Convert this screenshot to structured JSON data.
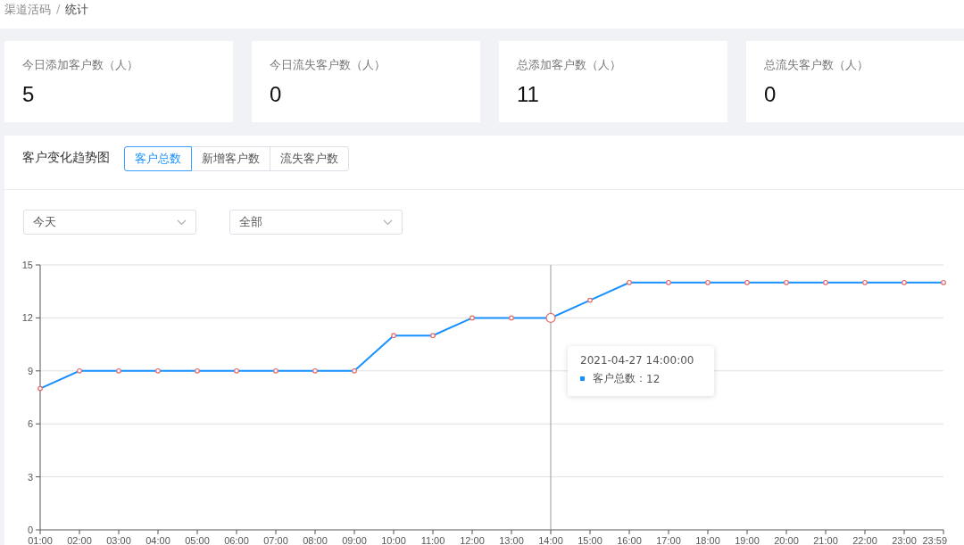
{
  "breadcrumb": [
    {
      "label": "渠道活码"
    },
    {
      "label": "统计"
    }
  ],
  "breadcrumb_separator": "/",
  "stats": [
    {
      "label": "今日添加客户数（人）",
      "value": "5"
    },
    {
      "label": "今日流失客户数（人）",
      "value": "0"
    },
    {
      "label": "总添加客户数（人）",
      "value": "11"
    },
    {
      "label": "总流失客户数（人）",
      "value": "0"
    }
  ],
  "trend": {
    "title": "客户变化趋势图",
    "tabs": [
      {
        "label": "客户总数",
        "selected": true
      },
      {
        "label": "新增客户数",
        "selected": false
      },
      {
        "label": "流失客户数",
        "selected": false
      }
    ],
    "filters": [
      {
        "value": "今天"
      },
      {
        "value": "全部"
      }
    ],
    "chart_data": {
      "type": "line",
      "categories": [
        "01:00",
        "02:00",
        "03:00",
        "04:00",
        "05:00",
        "06:00",
        "07:00",
        "08:00",
        "09:00",
        "10:00",
        "11:00",
        "12:00",
        "13:00",
        "14:00",
        "15:00",
        "16:00",
        "17:00",
        "18:00",
        "19:00",
        "20:00",
        "21:00",
        "22:00",
        "23:00",
        "23:59"
      ],
      "series": [
        {
          "name": "客户总数",
          "color": "#1890ff",
          "marker": "circle",
          "values": [
            8,
            9,
            9,
            9,
            9,
            9,
            9,
            9,
            9,
            11,
            11,
            12,
            12,
            12,
            13,
            14,
            14,
            14,
            14,
            14,
            14,
            14,
            14,
            14
          ]
        }
      ],
      "ylim": [
        0,
        15
      ],
      "yticks": [
        0,
        3,
        6,
        9,
        12,
        15
      ],
      "grid": true,
      "ref_lines": [
        {
          "axis": "x",
          "value": "14:00"
        }
      ]
    },
    "tooltip": {
      "title": "2021-04-27 14:00:00",
      "separator": "：",
      "value": "12"
    }
  }
}
